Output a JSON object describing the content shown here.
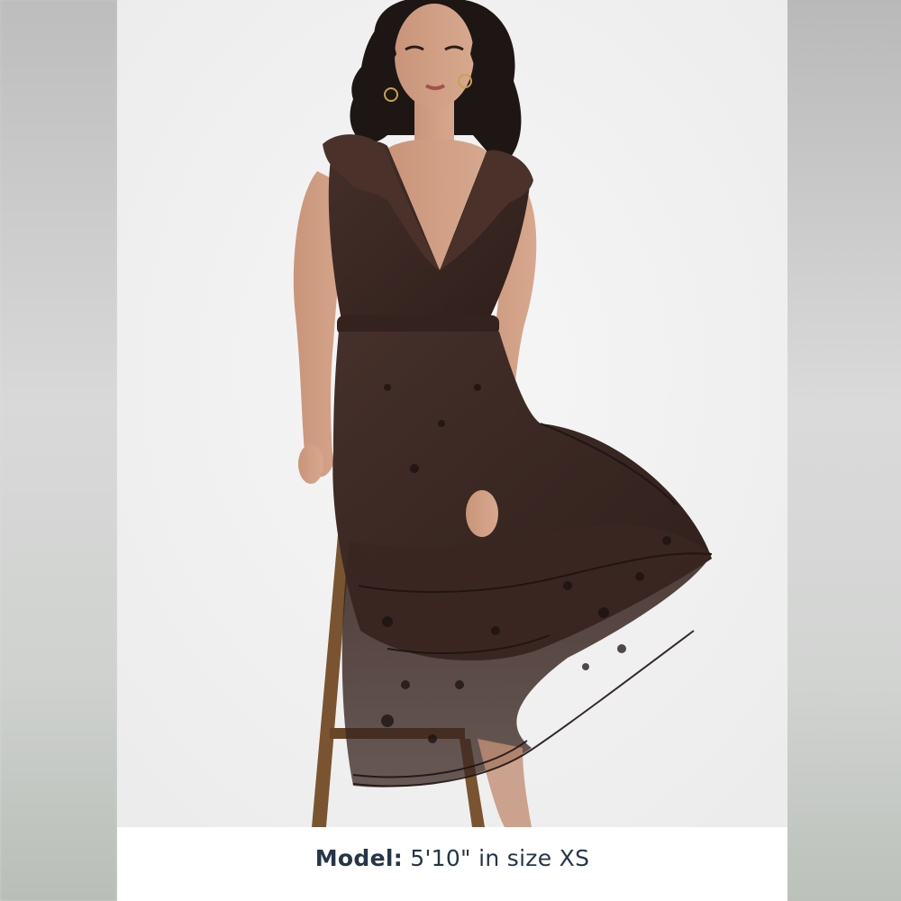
{
  "caption": {
    "label": "Model:",
    "value": "5'10\" in size XS"
  },
  "colors": {
    "dress": "#3a2621",
    "caption_text": "#263548",
    "background": "#f1f1f1",
    "stool": "#7a5430"
  }
}
